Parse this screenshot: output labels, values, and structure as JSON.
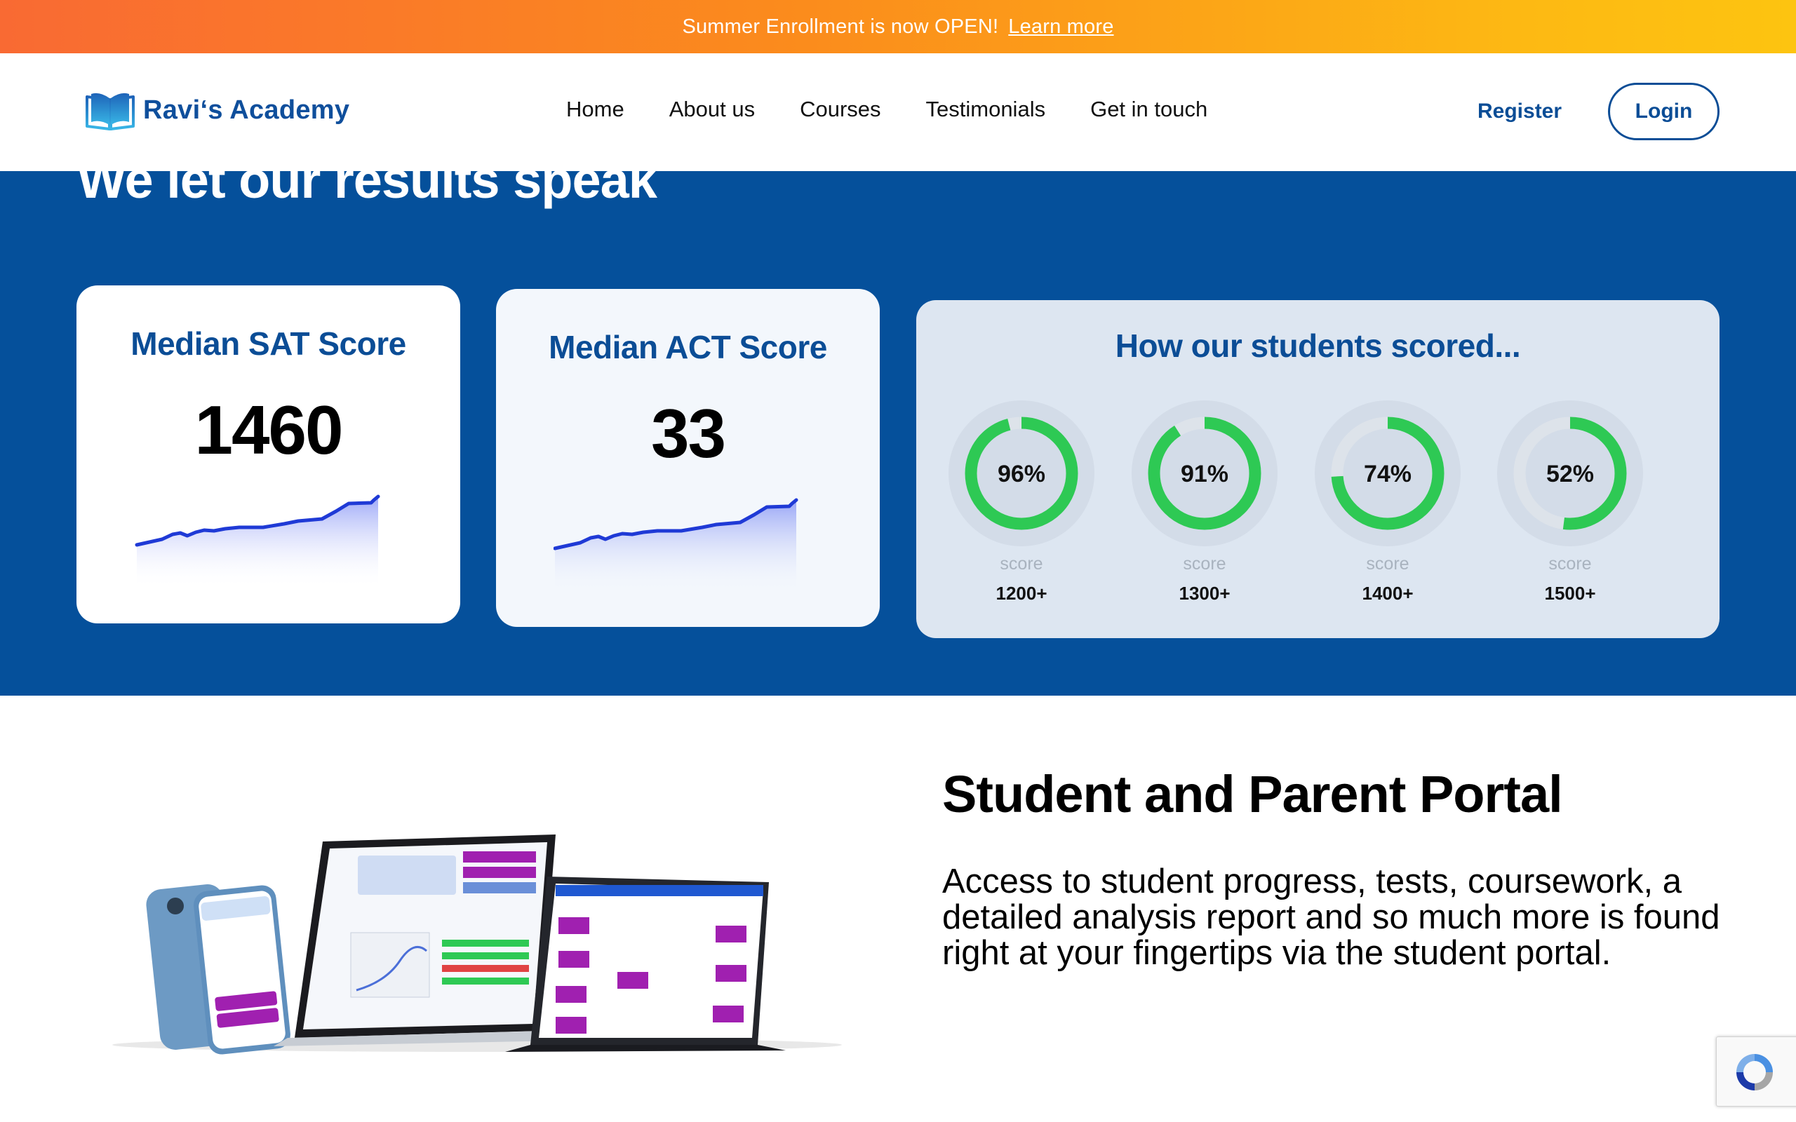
{
  "announcement": {
    "text": "Summer Enrollment is now OPEN!",
    "link": "Learn more"
  },
  "header": {
    "brand": "Ravi‘s Academy",
    "nav": [
      "Home",
      "About us",
      "Courses",
      "Testimonials",
      "Get in touch"
    ],
    "register": "Register",
    "login": "Login"
  },
  "results": {
    "heading": "We let our results speak",
    "sat": {
      "title": "Median SAT Score",
      "value": "1460"
    },
    "act": {
      "title": "Median ACT Score",
      "value": "33"
    },
    "distribution": {
      "title": "How our students scored...",
      "items": [
        {
          "percent_label": "96%",
          "percent": 96,
          "caption": "score",
          "range": "1200+"
        },
        {
          "percent_label": "91%",
          "percent": 91,
          "caption": "score",
          "range": "1300+"
        },
        {
          "percent_label": "74%",
          "percent": 74,
          "caption": "score",
          "range": "1400+"
        },
        {
          "percent_label": "52%",
          "percent": 52,
          "caption": "score",
          "range": "1500+"
        }
      ]
    }
  },
  "portal": {
    "title": "Student and Parent Portal",
    "text": "Access to student progress, tests, coursework, a detailed analysis report and so much more is found right at your fingertips via the student portal."
  },
  "colors": {
    "brand_blue": "#05509b",
    "accent_green": "#2ec954",
    "banner_start": "#f96a33",
    "banner_end": "#fdc410"
  }
}
